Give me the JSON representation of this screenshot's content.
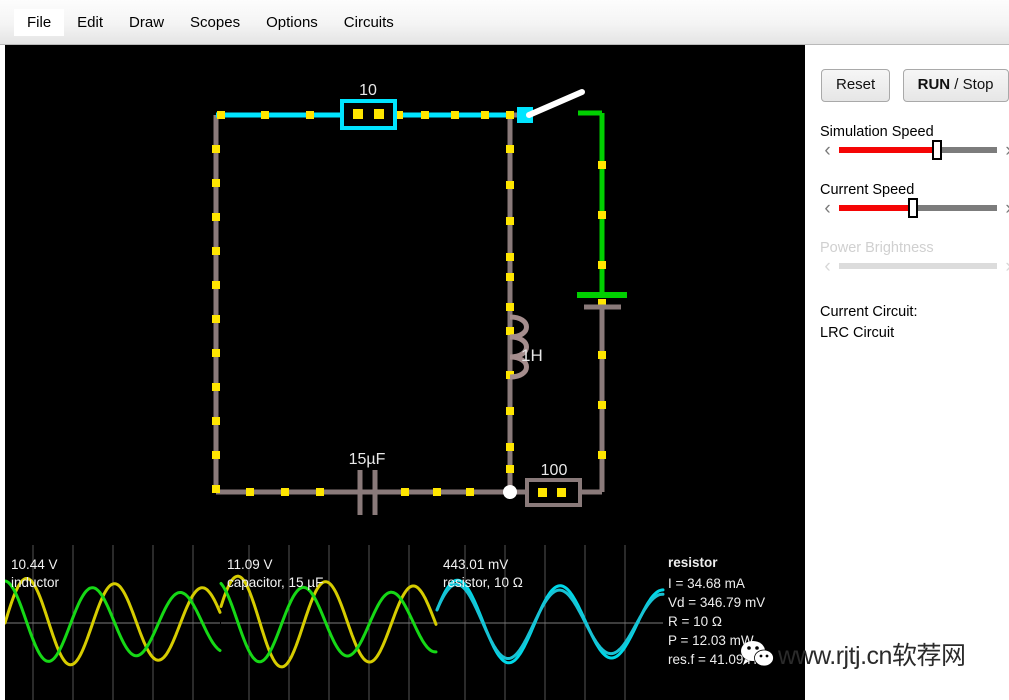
{
  "menu": {
    "items": [
      {
        "label": "File",
        "active": true
      },
      {
        "label": "Edit",
        "active": false
      },
      {
        "label": "Draw",
        "active": false
      },
      {
        "label": "Scopes",
        "active": false
      },
      {
        "label": "Options",
        "active": false
      },
      {
        "label": "Circuits",
        "active": false
      }
    ]
  },
  "sidebar": {
    "reset_label": "Reset",
    "run_label": "RUN",
    "run_separator": " / ",
    "stop_label": "Stop",
    "sliders": [
      {
        "label": "Simulation Speed",
        "value_pct": 62,
        "enabled": true
      },
      {
        "label": "Current Speed",
        "value_pct": 47,
        "enabled": true
      },
      {
        "label": "Power Brightness",
        "value_pct": 0,
        "enabled": false
      }
    ],
    "left_arrow": "‹",
    "right_arrow": "›",
    "circuit_info_label": "Current Circuit:",
    "circuit_name": "LRC Circuit"
  },
  "circuit": {
    "components": [
      {
        "name": "resistor-top",
        "label": "10",
        "selected": true
      },
      {
        "name": "inductor",
        "label": "1H",
        "selected": false
      },
      {
        "name": "capacitor",
        "label": "15µF",
        "selected": false
      },
      {
        "name": "resistor-bottom",
        "label": "100",
        "selected": false
      },
      {
        "name": "switch",
        "label": "",
        "selected": false
      },
      {
        "name": "battery",
        "label": "",
        "selected": false
      }
    ],
    "colors": {
      "wire": "#8a7a7a",
      "current_dot": "#ffe600",
      "selected": "#00e5ff",
      "positive_voltage": "#00d000",
      "background": "#000000",
      "node": "#ffffff"
    }
  },
  "scopes": [
    {
      "name": "inductor-scope",
      "value": "10.44 V",
      "label": "inductor",
      "traces": [
        {
          "color": "#d6cc00",
          "amplitude": 46,
          "phase": 0.0,
          "freq": 2.45,
          "decay": 0.1
        },
        {
          "color": "#16d816",
          "amplitude": 42,
          "phase": 1.57,
          "freq": 2.45,
          "decay": 0.14
        }
      ]
    },
    {
      "name": "capacitor-scope",
      "value": "11.09 V",
      "label": "capacitor, 15 µF",
      "traces": [
        {
          "color": "#d6cc00",
          "amplitude": 48,
          "phase": 0.35,
          "freq": 2.45,
          "decay": 0.1
        },
        {
          "color": "#16d816",
          "amplitude": 42,
          "phase": 1.92,
          "freq": 2.45,
          "decay": 0.14
        }
      ]
    },
    {
      "name": "resistor-scope",
      "value": "443.01 mV",
      "label": "resistor, 10 Ω",
      "traces": [
        {
          "color": "#00d8e8",
          "amplitude": 44,
          "phase": 0.3,
          "freq": 2.2,
          "decay": 0.1
        },
        {
          "color": "#18c2d4",
          "amplitude": 40,
          "phase": 0.34,
          "freq": 2.2,
          "decay": 0.12
        }
      ]
    }
  ],
  "readout": {
    "title": "resistor",
    "lines": [
      "I = 34.68 mA",
      "Vd = 346.79 mV",
      "R = 10 Ω",
      "P = 12.03 mW",
      "res.f = 41.09 Hz"
    ]
  },
  "watermark": {
    "text": "www.rjtj.cn软荐网"
  }
}
